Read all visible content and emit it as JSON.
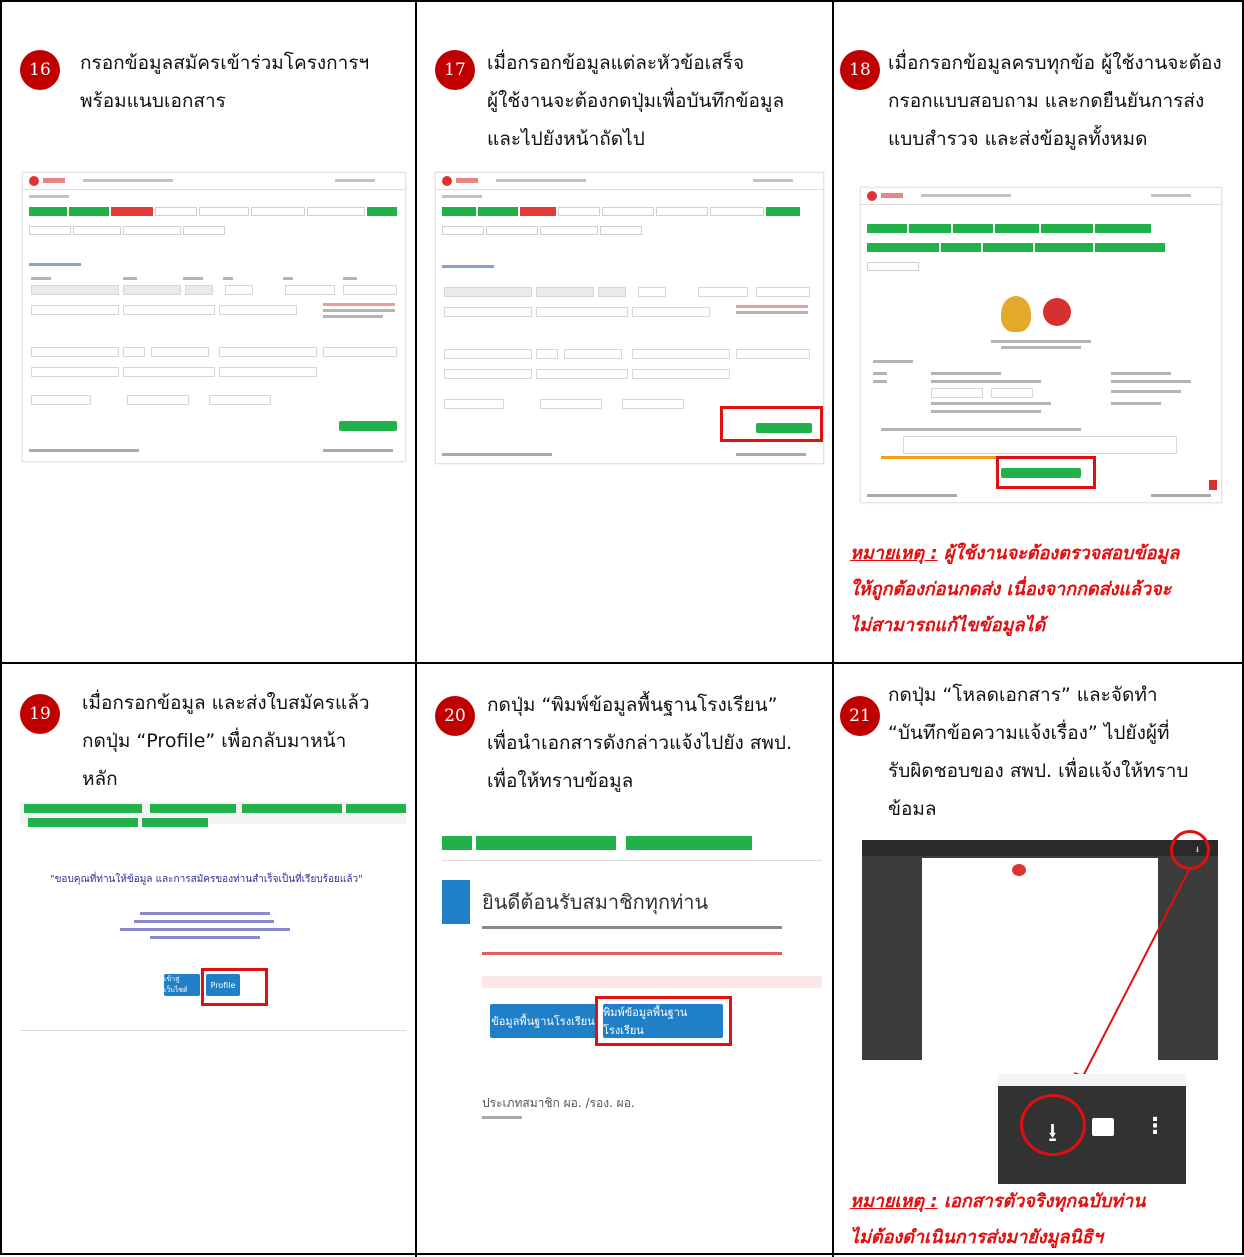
{
  "steps": [
    {
      "number": "16",
      "lines": [
        "กรอกข้อมูลสมัครเข้าร่วมโครงการฯ",
        "พร้อมแนบเอกสาร"
      ]
    },
    {
      "number": "17",
      "lines": [
        "เมื่อกรอกข้อมูลแต่ละหัวข้อเสร็จ",
        "ผู้ใช้งานจะต้องกดปุ่มเพื่อบันทึกข้อมูล",
        "และไปยังหน้าถัดไป"
      ]
    },
    {
      "number": "18",
      "lines": [
        "เมื่อกรอกข้อมูลครบทุกข้อ ผู้ใช้งานจะต้อง",
        "กรอกแบบสอบถาม และกดยืนยันการส่ง",
        "แบบสำรวจ และส่งข้อมูลทั้งหมด"
      ]
    },
    {
      "number": "19",
      "lines": [
        "เมื่อกรอกข้อมูล และส่งใบสมัครแล้ว",
        "กดปุ่ม “Profile” เพื่อกลับมาหน้า",
        "หลัก"
      ]
    },
    {
      "number": "20",
      "lines": [
        "กดปุ่ม “พิมพ์ข้อมูลพื้นฐานโรงเรียน”",
        "เพื่อนำเอกสารดังกล่าวแจ้งไปยัง สพป.",
        "เพื่อให้ทราบข้อมูล"
      ]
    },
    {
      "number": "21",
      "lines": [
        "กดปุ่ม “โหลดเอกสาร” และจัดทำ",
        "“บันทึกข้อความแจ้งเรื่อง” ไปยังผู้ที่",
        "รับผิดชอบของ สพป. เพื่อแจ้งให้ทราบ",
        "ข้อมล"
      ]
    }
  ],
  "note18": {
    "label": "หมายเหตุ :",
    "lines": [
      " ผู้ใช้งานจะต้องตรวจสอบข้อมูล",
      "ให้ถูกต้องก่อนกดส่ง เนื่องจากกดส่งแล้วจะ",
      "ไม่สามารถแก้ไขข้อมูลได้"
    ]
  },
  "note21": {
    "label": "หมายเหตุ :",
    "lines": [
      " เอกสารตัวจริงทุกฉบับท่าน",
      "ไม่ต้องดำเนินการส่งมายังมูลนิธิฯ"
    ]
  },
  "shot19": {
    "thanks": "\"ขอบคุณที่ท่านให้ข้อมูล และการสมัครของท่านสำเร็จเป็นที่เรียบร้อยแล้ว\"",
    "btn_home": "เข้าสู่เว็บไซต์",
    "btn_profile": "Profile"
  },
  "shot20": {
    "welcome": "ยินดีต้อนรับสมาชิกทุกท่าน",
    "btn_basic": "ข้อมูลพื้นฐานโรงเรียน",
    "btn_print": "พิมพ์ข้อมูลพื้นฐานโรงเรียน",
    "member_type": "ประเภทสมาชิก ผอ. /รอง. ผอ."
  },
  "icons": {
    "download": "download-icon",
    "print": "print-icon",
    "more": "more-vertical-icon"
  },
  "colors": {
    "accent_red": "#c00000",
    "note_red": "#e01010",
    "green": "#21b14b",
    "blue": "#1f7fc7"
  }
}
